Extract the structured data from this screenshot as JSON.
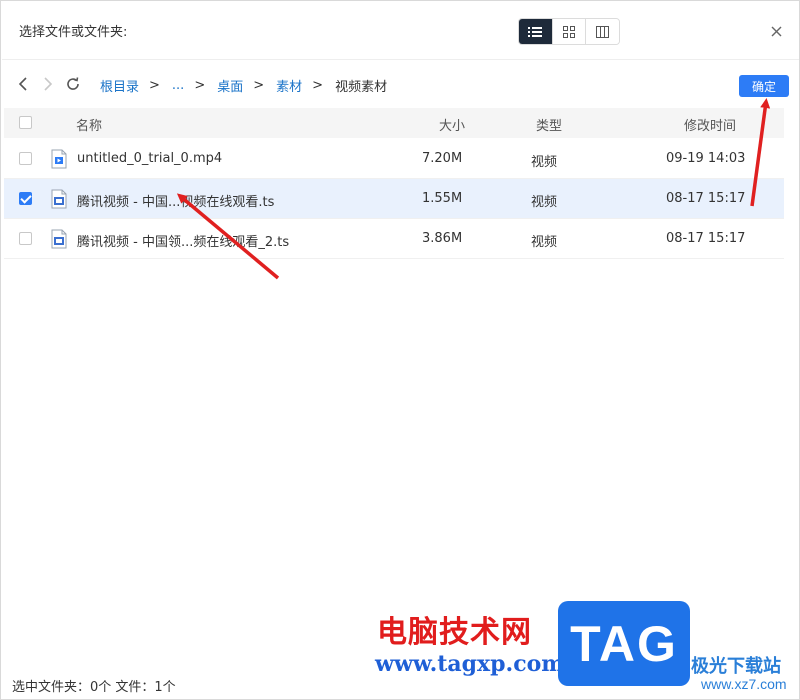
{
  "dialog": {
    "title": "选择文件或文件夹:"
  },
  "view_modes": [
    "list-view",
    "grid-view",
    "column-view"
  ],
  "breadcrumb": [
    "根目录",
    "...",
    "桌面",
    "素材",
    "视频素材"
  ],
  "breadcrumb_separator": ">",
  "ok_button": "确定",
  "table": {
    "headers": {
      "name": "名称",
      "size": "大小",
      "type": "类型",
      "modified": "修改时间"
    },
    "rows": [
      {
        "name": "untitled_0_trial_0.mp4",
        "size": "7.20M",
        "type": "视频",
        "modified": "09-19 14:03",
        "checked": false,
        "icon": "video-file-icon"
      },
      {
        "name": "腾讯视频 - 中国...视频在线观看.ts",
        "size": "1.55M",
        "type": "视频",
        "modified": "08-17 15:17",
        "checked": true,
        "icon": "ts-file-icon"
      },
      {
        "name": "腾讯视频 - 中国领...频在线观看_2.ts",
        "size": "3.86M",
        "type": "视频",
        "modified": "08-17 15:17",
        "checked": false,
        "icon": "ts-file-icon"
      }
    ]
  },
  "status_bar": "选中文件夹：0个  文件：1个",
  "watermark": {
    "cn_text": "电脑技术网",
    "url": "www.tagxp.com",
    "logo": "TAG",
    "brand": "极光下载站",
    "brand_url": "www.xz7.com"
  },
  "colors": {
    "accent": "#2d7cf6",
    "selected_row": "#e9f1fd",
    "annotation_arrow": "#e02020",
    "active_view": "#1e2a3a"
  }
}
